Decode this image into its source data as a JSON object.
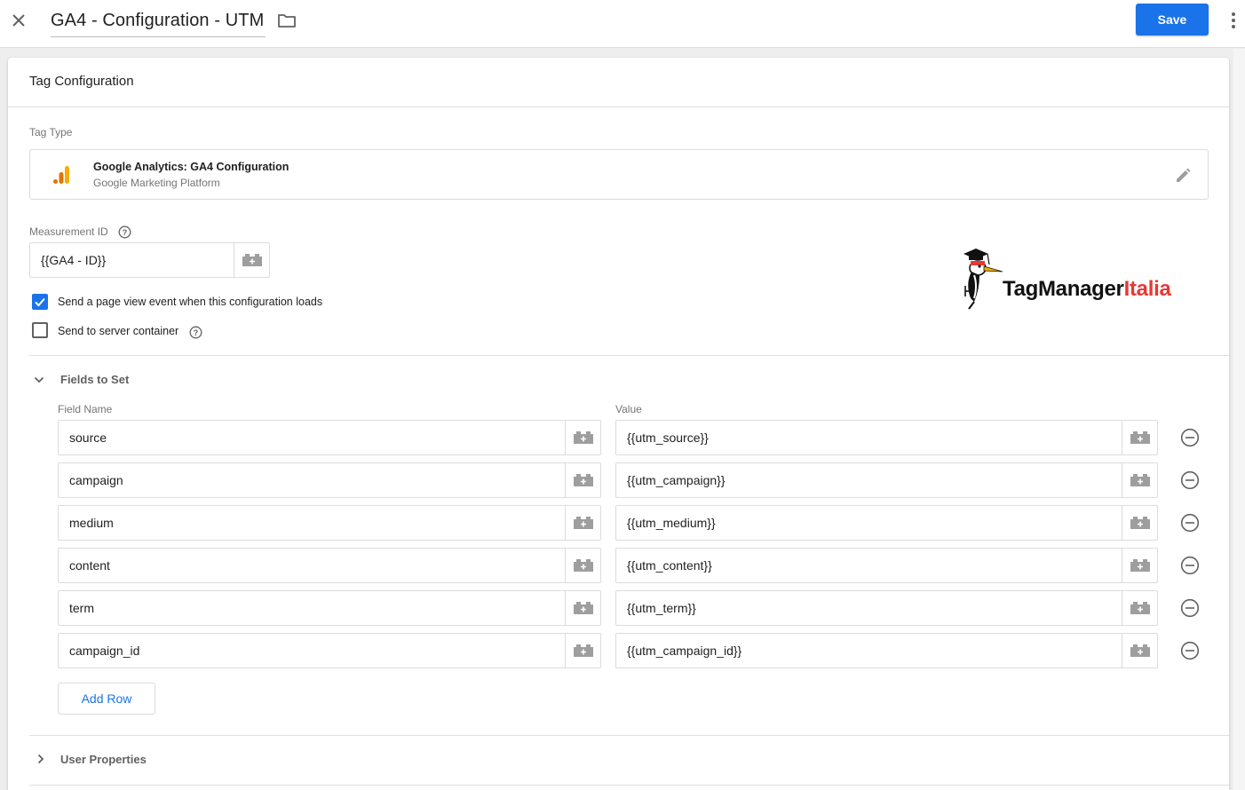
{
  "header": {
    "title": "GA4 - Configuration - UTM",
    "save_label": "Save"
  },
  "card": {
    "title": "Tag Configuration"
  },
  "tag_type": {
    "label": "Tag Type",
    "name": "Google Analytics: GA4 Configuration",
    "provider": "Google Marketing Platform"
  },
  "measurement": {
    "label": "Measurement ID",
    "value": "{{GA4 - ID}}"
  },
  "options": {
    "page_view_label": "Send a page view event when this configuration loads",
    "page_view_checked": true,
    "server_label": "Send to server container",
    "server_checked": false
  },
  "logo": {
    "part1": "TagManager",
    "part2": "Italia",
    "color1": "#111111",
    "color2": "#e53935"
  },
  "fields_to_set": {
    "title": "Fields to Set",
    "expanded": true,
    "col_name": "Field Name",
    "col_value": "Value",
    "rows": [
      {
        "name": "source",
        "value": "{{utm_source}}"
      },
      {
        "name": "campaign",
        "value": "{{utm_campaign}}"
      },
      {
        "name": "medium",
        "value": "{{utm_medium}}"
      },
      {
        "name": "content",
        "value": "{{utm_content}}"
      },
      {
        "name": "term",
        "value": "{{utm_term}}"
      },
      {
        "name": "campaign_id",
        "value": "{{utm_campaign_id}}"
      }
    ],
    "add_row_label": "Add Row"
  },
  "user_properties": {
    "title": "User Properties",
    "expanded": false
  },
  "colors": {
    "accent": "#1a73e8",
    "ga_orange": "#f9ab00",
    "ga_dark_orange": "#e37400"
  },
  "icons": {
    "close": "close-icon",
    "folder": "folder-icon",
    "more": "more-vert-icon",
    "edit": "pencil-icon",
    "variable": "variable-picker-icon",
    "remove": "remove-circle-icon",
    "help": "help-icon"
  }
}
